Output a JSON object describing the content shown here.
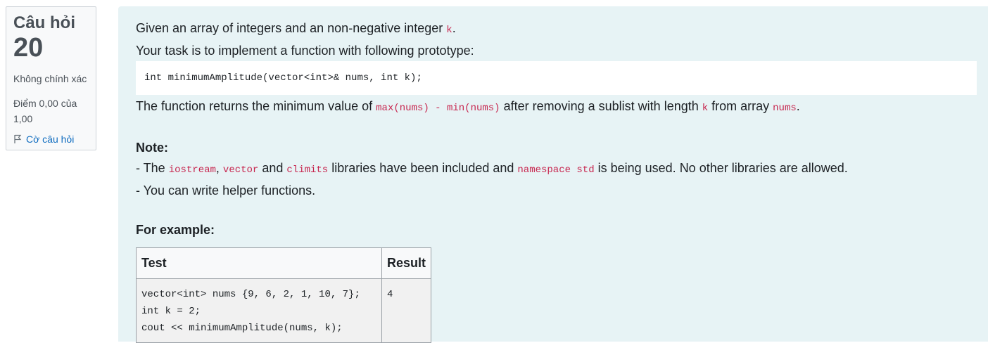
{
  "question_info": {
    "label": "Câu hỏi",
    "number": "20",
    "state": "Không chính xác",
    "grade": "Điểm 0,00 của 1,00",
    "flag_label": "Cờ câu hỏi"
  },
  "problem": {
    "intro_text": "Given an array of integers and an non-negative integer ",
    "intro_code": "k",
    "intro_end": ".",
    "task_text": "Your task is to implement a function with following prototype:",
    "prototype": "int minimumAmplitude(vector<int>& nums, int k);",
    "returns_1": "The function returns the minimum value of ",
    "returns_code1": "max(nums) - min(nums)",
    "returns_2": " after removing a sublist with length ",
    "returns_code2": "k",
    "returns_3": " from array ",
    "returns_code3": "nums",
    "returns_4": ".",
    "note_heading": "Note:",
    "note1_a": "- The ",
    "note1_code1": "iostream",
    "note1_b": ", ",
    "note1_code2": "vector",
    "note1_c": " and ",
    "note1_code3": "climits",
    "note1_d": " libraries have been included and ",
    "note1_code4": "namespace std",
    "note1_e": " is being used. No other libraries are allowed.",
    "note2": "- You can write helper functions.",
    "example_heading": "For example:"
  },
  "example_table": {
    "headers": [
      "Test",
      "Result"
    ],
    "test_lines": [
      "vector<int> nums {9, 6, 2, 1, 10, 7};",
      "int k = 2;",
      "cout << minimumAmplitude(nums, k);"
    ],
    "result": "4"
  },
  "colors": {
    "content_bg": "#e7f3f5",
    "inline_code": "#c7254e",
    "link": "#0f6cbf"
  }
}
